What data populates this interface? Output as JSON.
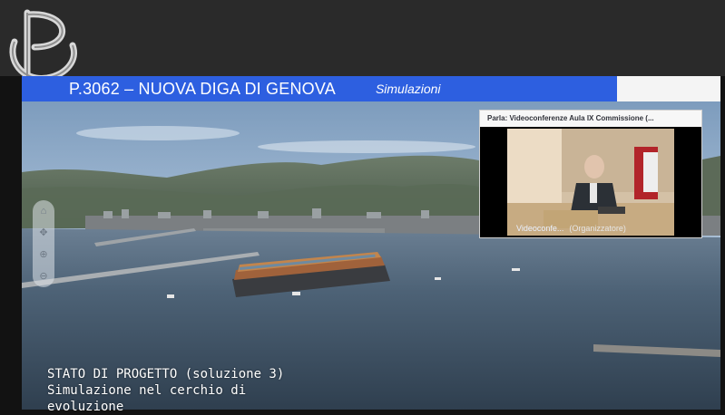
{
  "header": {
    "title": "P.3062 – NUOVA DIGA DI GENOVA",
    "section": "Simulazioni"
  },
  "video_call": {
    "speaker_label": "Parla: Videoconferenze Aula IX Commissione (...",
    "participant_name": "Videoconfe...",
    "participant_role": "(Organizzatore)"
  },
  "caption": {
    "line1": "STATO DI PROGETTO (soluzione 3)",
    "line2": "Simulazione nel cerchio di",
    "line3": "evoluzione"
  },
  "controls": {
    "icons": [
      "home-icon",
      "pan-icon",
      "zoom-in-icon",
      "zoom-out-icon"
    ]
  },
  "colors": {
    "title_bar": "#2d5fe0",
    "sea": "#4a5f74",
    "sky": "#a6bfd7"
  }
}
